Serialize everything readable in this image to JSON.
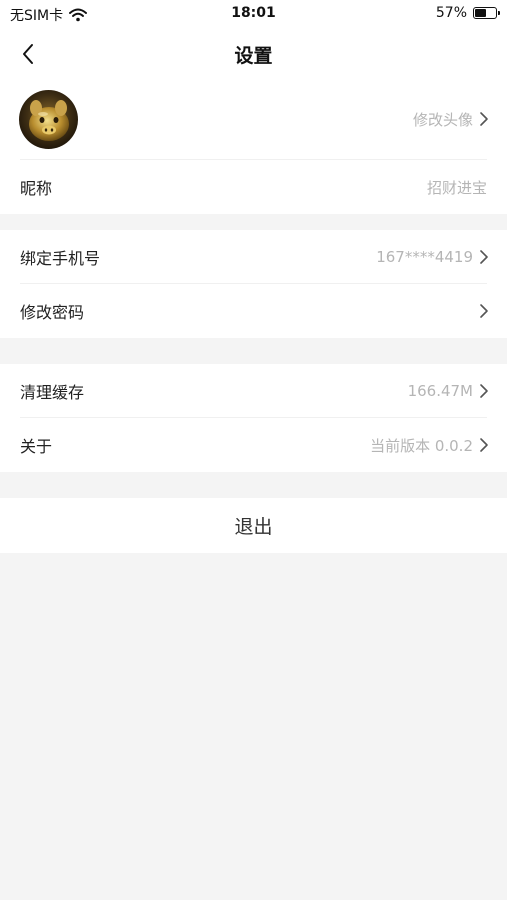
{
  "status_bar": {
    "carrier": "无SIM卡",
    "time": "18:01",
    "battery_percent": "57%",
    "battery_level": 0.57
  },
  "nav": {
    "title": "设置",
    "back_icon": "chevron-left-icon"
  },
  "profile": {
    "avatar_action": "修改头像",
    "nickname_label": "昵称",
    "nickname_value": "招财进宝"
  },
  "account": {
    "phone_label": "绑定手机号",
    "phone_value": "167****4419",
    "password_label": "修改密码"
  },
  "app": {
    "cache_label": "清理缓存",
    "cache_value": "166.47M",
    "about_label": "关于",
    "about_value": "当前版本 0.0.2"
  },
  "logout_label": "退出",
  "colors": {
    "page_background": "#f4f4f4",
    "card_background": "#ffffff",
    "secondary_text": "#b5b5b5",
    "primary_text": "#222222"
  }
}
